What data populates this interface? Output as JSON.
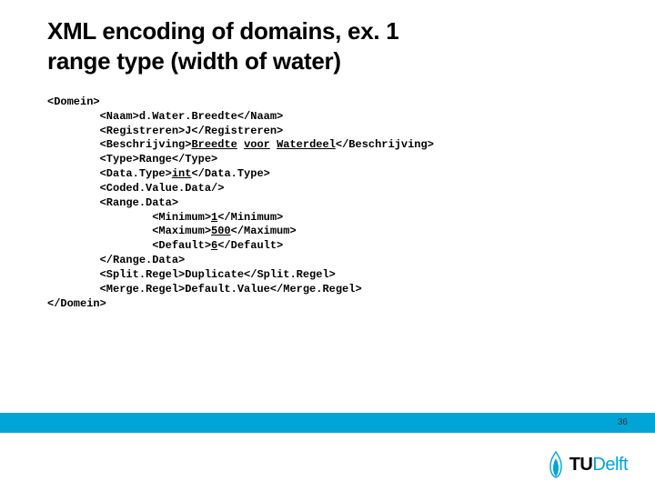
{
  "title_line1": "XML encoding of domains, ex. 1",
  "title_line2": "range type (width of water)",
  "code": {
    "l01": "<Domein>",
    "l02_a": "        <Naam>d.",
    "l02_b": "Water.",
    "l02_c": "Breedte</Naam>",
    "l03": "        <Registreren>J</Registreren>",
    "l04_a": "        <Beschrijving>",
    "l04_b": "Breedte",
    "l04_c": " ",
    "l04_d": "voor",
    "l04_e": " ",
    "l04_f": "Waterdeel",
    "l04_g": "</Beschrijving>",
    "l05": "        <Type>Range</Type>",
    "l06_a": "        <Data.Type>",
    "l06_b": "int",
    "l06_c": "</Data.Type>",
    "l07": "        <Coded.Value.Data/>",
    "l08": "        <Range.Data>",
    "l09_a": "                <Minimum>",
    "l09_b": "1",
    "l09_c": "</Minimum>",
    "l10_a": "                <Maximum>",
    "l10_b": "500",
    "l10_c": "</Maximum>",
    "l11_a": "                <Default>",
    "l11_b": "6",
    "l11_c": "</Default>",
    "l12": "        </Range.Data>",
    "l13": "        <Split.Regel>Duplicate</Split.Regel>",
    "l14": "        <Merge.Regel>Default.Value</Merge.Regel>",
    "l15": "</Domein>"
  },
  "page_number": "36",
  "logo_tu": "TU",
  "logo_delft": "Delft"
}
